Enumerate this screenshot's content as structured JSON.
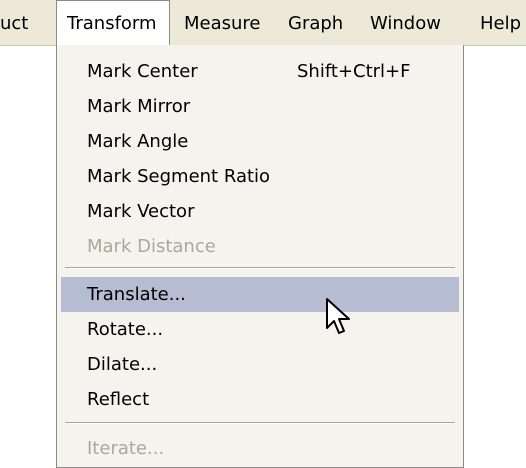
{
  "menubar": {
    "items": [
      "uct",
      "Transform",
      "Measure",
      "Graph",
      "Window",
      "Help"
    ]
  },
  "transform_menu": {
    "groups": [
      [
        {
          "label": "Mark Center",
          "shortcut": "Shift+Ctrl+F",
          "enabled": true
        },
        {
          "label": "Mark Mirror",
          "enabled": true
        },
        {
          "label": "Mark Angle",
          "enabled": true
        },
        {
          "label": "Mark Segment Ratio",
          "enabled": true
        },
        {
          "label": "Mark Vector",
          "enabled": true
        },
        {
          "label": "Mark Distance",
          "enabled": false
        }
      ],
      [
        {
          "label": "Translate...",
          "enabled": true,
          "highlighted": true
        },
        {
          "label": "Rotate...",
          "enabled": true
        },
        {
          "label": "Dilate...",
          "enabled": true
        },
        {
          "label": "Reflect",
          "enabled": true
        }
      ],
      [
        {
          "label": "Iterate...",
          "enabled": false
        }
      ]
    ]
  },
  "cursor": {
    "icon": "arrow-pointer-icon"
  }
}
